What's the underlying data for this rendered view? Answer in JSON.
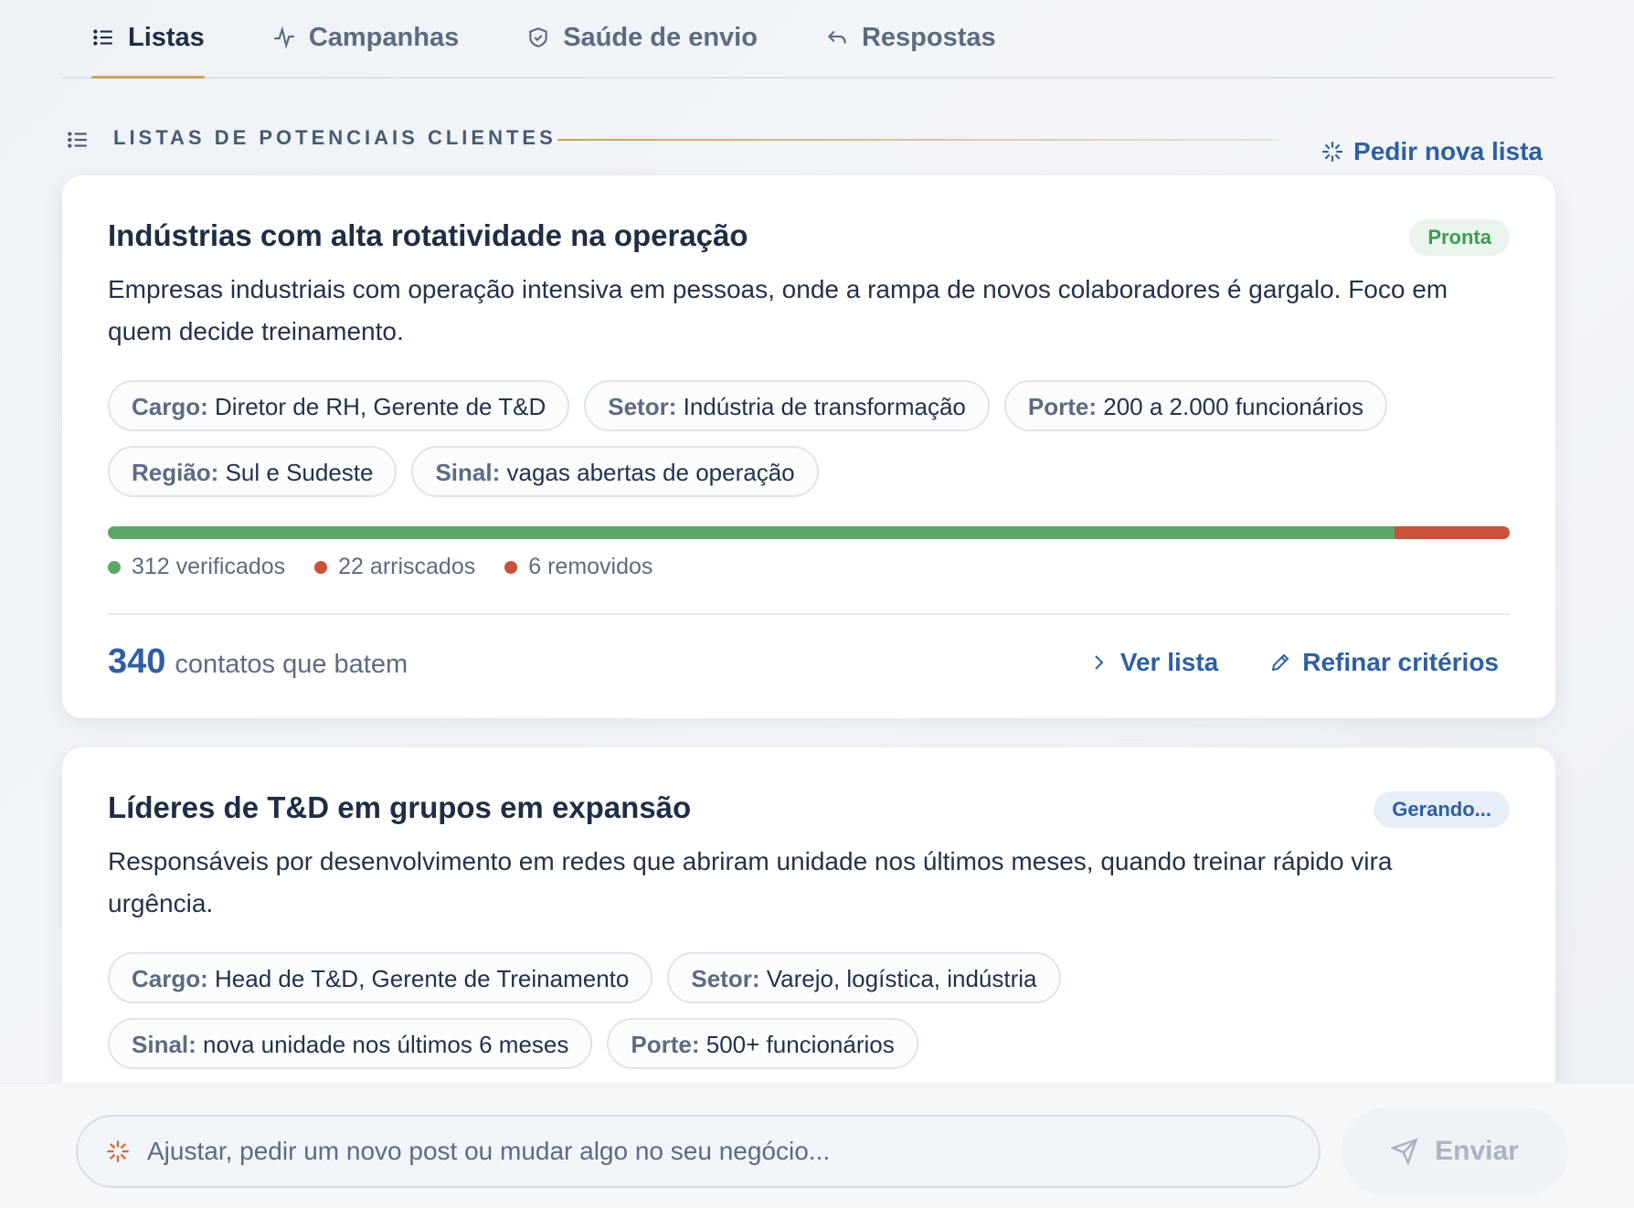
{
  "tabs": [
    {
      "label": "Listas",
      "icon": "list-icon",
      "active": true
    },
    {
      "label": "Campanhas",
      "icon": "activity-icon",
      "active": false
    },
    {
      "label": "Saúde de envio",
      "icon": "shield-icon",
      "active": false
    },
    {
      "label": "Respostas",
      "icon": "reply-icon",
      "active": false
    }
  ],
  "section": {
    "title": "LISTAS DE POTENCIAIS CLIENTES",
    "action_label": "Pedir nova lista"
  },
  "cards": [
    {
      "title": "Indústrias com alta rotatividade na operação",
      "status": "Pronta",
      "description": "Empresas industriais com operação intensiva em pessoas, onde a rampa de novos colaboradores é gargalo. Foco em quem decide treinamento.",
      "chips": [
        {
          "key": "Cargo:",
          "value": "Diretor de RH, Gerente de T&D"
        },
        {
          "key": "Setor:",
          "value": "Indústria de transformação"
        },
        {
          "key": "Porte:",
          "value": "200 a 2.000 funcionários"
        },
        {
          "key": "Região:",
          "value": "Sul e Sudeste"
        },
        {
          "key": "Sinal:",
          "value": "vagas abertas de operação"
        }
      ],
      "progress": {
        "verified_fraction": 0.918,
        "risky_fraction": 0.082
      },
      "legend": {
        "verified": "312 verificados",
        "risky": "22 arriscados",
        "removed": "6 removidos"
      },
      "count": "340",
      "count_label": "contatos que batem",
      "view_label": "Ver lista",
      "refine_label": "Refinar critérios"
    },
    {
      "title": "Líderes de T&D em grupos em expansão",
      "status": "Gerando...",
      "description": "Responsáveis por desenvolvimento em redes que abriram unidade nos últimos meses, quando treinar rápido vira urgência.",
      "chips": [
        {
          "key": "Cargo:",
          "value": "Head de T&D, Gerente de Treinamento"
        },
        {
          "key": "Setor:",
          "value": "Varejo, logística, indústria"
        },
        {
          "key": "Sinal:",
          "value": "nova unidade nos últimos 6 meses"
        },
        {
          "key": "Porte:",
          "value": "500+ funcionários"
        }
      ]
    }
  ],
  "composer": {
    "placeholder": "Ajustar, pedir um novo post ou mudar algo no seu negócio...",
    "send_label": "Enviar"
  },
  "colors": {
    "accent": "#2d5fa3",
    "gold": "#c7a35a",
    "verified": "#5aa865",
    "risky": "#c9513a"
  }
}
